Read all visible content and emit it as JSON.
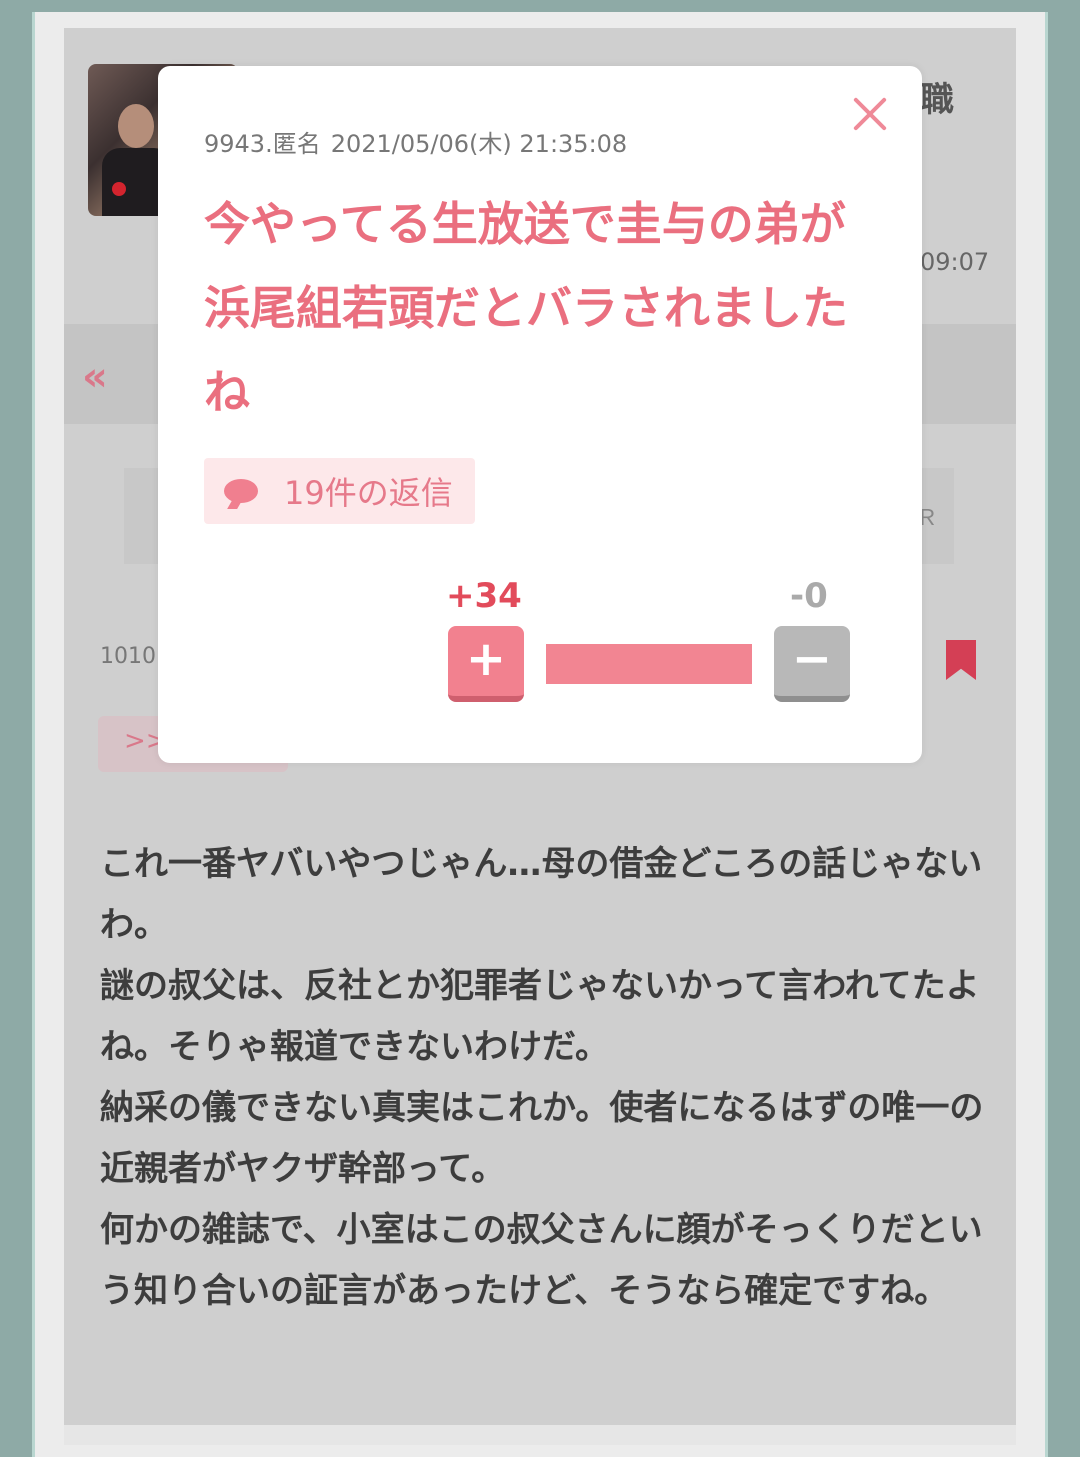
{
  "background": {
    "title_fragment": "職",
    "time_fragment": "09:07",
    "back_icon": "«",
    "box_fragment": "Ｒ",
    "comment_number_fragment": "1010",
    "reply_fragment": ">>",
    "body": "これ一番ヤバいやつじゃん…母の借金どころの話じゃないわ。\n謎の叔父は、反社とか犯罪者じゃないかって言われてたよね。そりゃ報道できないわけだ。\n納采の儀できない真実はこれか。使者になるはずの唯一の近親者がヤクザ幹部って。\n何かの雑誌で、小室はこの叔父さんに顔がそっくりだという知り合いの証言があったけど、そうなら確定ですね。"
  },
  "modal": {
    "number": "9943.匿名",
    "date": "2021/05/06(木) 21:35:08",
    "comment": "今やってる生放送で圭与の弟が浜尾組若頭だとバラされましたね",
    "replies_label": "19件の返信",
    "plus_count": "+34",
    "minus_count": "-0",
    "plus_symbol": "+",
    "minus_symbol": "−",
    "plus_ratio": 1.0
  },
  "colors": {
    "accent": "#ea6f7f",
    "plus_button": "#f2818f",
    "minus_button": "#b8b8b8"
  }
}
